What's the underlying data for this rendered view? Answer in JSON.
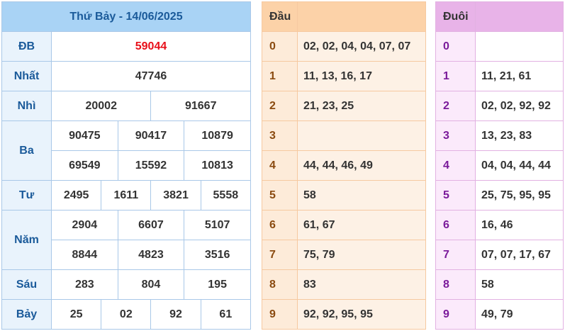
{
  "results": {
    "title": "Thứ Bảy - 14/06/2025",
    "db": {
      "label": "ĐB",
      "values": [
        "59044"
      ],
      "color": "#e8101a"
    },
    "nhat": {
      "label": "Nhất",
      "values": [
        "47746"
      ]
    },
    "nhi": {
      "label": "Nhì",
      "values": [
        "20002",
        "91667"
      ]
    },
    "ba": {
      "label": "Ba",
      "values": [
        "90475",
        "90417",
        "10879",
        "69549",
        "15592",
        "10813"
      ]
    },
    "tu": {
      "label": "Tư",
      "values": [
        "2495",
        "1611",
        "3821",
        "5558"
      ]
    },
    "nam": {
      "label": "Năm",
      "values": [
        "2904",
        "6607",
        "5107",
        "8844",
        "4823",
        "3516"
      ]
    },
    "sau": {
      "label": "Sáu",
      "values": [
        "283",
        "804",
        "195"
      ]
    },
    "bay": {
      "label": "Bảy",
      "values": [
        "25",
        "02",
        "92",
        "61"
      ]
    }
  },
  "head": {
    "title": "Đầu",
    "rows": [
      {
        "digit": "0",
        "values": "02, 02, 04, 04, 07, 07"
      },
      {
        "digit": "1",
        "values": "11, 13, 16, 17"
      },
      {
        "digit": "2",
        "values": "21, 23, 25"
      },
      {
        "digit": "3",
        "values": ""
      },
      {
        "digit": "4",
        "values": "44, 44, 46, 49"
      },
      {
        "digit": "5",
        "values": "58"
      },
      {
        "digit": "6",
        "values": "61, 67"
      },
      {
        "digit": "7",
        "values": "75, 79"
      },
      {
        "digit": "8",
        "values": "83"
      },
      {
        "digit": "9",
        "values": "92, 92, 95, 95"
      }
    ]
  },
  "tail": {
    "title": "Đuôi",
    "rows": [
      {
        "digit": "0",
        "values": ""
      },
      {
        "digit": "1",
        "values": "11, 21, 61"
      },
      {
        "digit": "2",
        "values": "02, 02, 92, 92"
      },
      {
        "digit": "3",
        "values": "13, 23, 83"
      },
      {
        "digit": "4",
        "values": "04, 04, 44, 44"
      },
      {
        "digit": "5",
        "values": "25, 75, 95, 95"
      },
      {
        "digit": "6",
        "values": "16, 46"
      },
      {
        "digit": "7",
        "values": "07, 07, 17, 67"
      },
      {
        "digit": "8",
        "values": "58"
      },
      {
        "digit": "9",
        "values": "49, 79"
      }
    ]
  }
}
